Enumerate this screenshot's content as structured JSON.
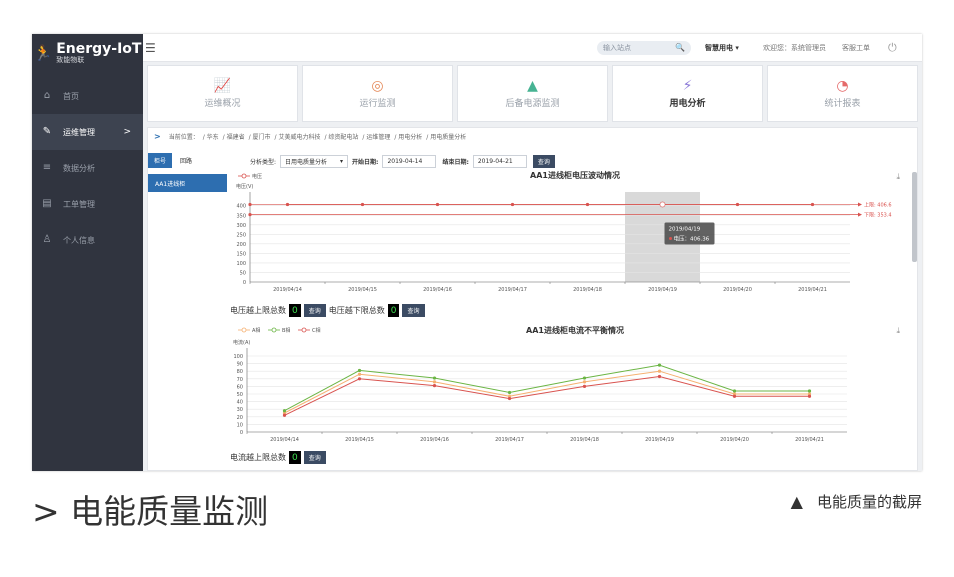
{
  "logo": {
    "name": "Energy-IoT",
    "sub": "致能物联"
  },
  "sidebar": {
    "items": [
      {
        "label": "首页",
        "icon": "home-icon"
      },
      {
        "label": "运维管理",
        "icon": "wrench-icon",
        "active": true,
        "arrow": ">"
      },
      {
        "label": "数据分析",
        "icon": "database-icon"
      },
      {
        "label": "工单管理",
        "icon": "document-icon"
      },
      {
        "label": "个人信息",
        "icon": "user-icon"
      }
    ]
  },
  "topbar": {
    "search_placeholder": "输入站点",
    "menu": "智慧用电",
    "welcome": "欢迎您：系统管理员",
    "service": "客服工单"
  },
  "modules": [
    {
      "label": "运维概况",
      "color": "#58b6d3"
    },
    {
      "label": "运行监测",
      "color": "#e58a5a"
    },
    {
      "label": "后备电源监测",
      "color": "#47b393"
    },
    {
      "label": "用电分析",
      "color": "#8c7ad8",
      "active": true
    },
    {
      "label": "统计报表",
      "color": "#e56a6a"
    }
  ],
  "breadcrumb": [
    "当前位置：",
    "/ 华东",
    "/ 福建省",
    "/ 厦门市",
    "/ 艾美威电力科技",
    "/ 综资配电站",
    "/ 运维管理",
    "/ 用电分析",
    "/ 用电质量分析"
  ],
  "tabs": [
    "柜号",
    "回路"
  ],
  "tree_node": "AA1进线柜",
  "filters": {
    "type_label": "分析类型:",
    "type_value": "日用电质量分析",
    "start_label": "开始日期:",
    "start_value": "2019-04-14",
    "end_label": "结束日期:",
    "end_value": "2019-04-21",
    "query": "查询"
  },
  "voltage_chart": {
    "chart_data": {
      "type": "line",
      "title": "AA1进线柜电压波动情况",
      "ylabel": "电压(V)",
      "categories": [
        "2019/04/14",
        "2019/04/15",
        "2019/04/16",
        "2019/04/17",
        "2019/04/18",
        "2019/04/19",
        "2019/04/20",
        "2019/04/21"
      ],
      "series": [
        {
          "name": "电压",
          "values": [
            406.4,
            406.4,
            406.4,
            406.4,
            406.4,
            406.36,
            406.4,
            406.4
          ],
          "color": "#d9534f"
        }
      ],
      "yticks": [
        0,
        50,
        100,
        150,
        200,
        250,
        300,
        350,
        400
      ],
      "ylim": [
        0,
        430
      ],
      "upper_label": "上限: 406.6",
      "lower_label": "下限: 353.4",
      "upper_value": 406.6,
      "lower_value": 353.4,
      "tooltip_date": "2019/04/19",
      "tooltip_text": "电压：406.36",
      "highlight_index": 5
    }
  },
  "voltage_stats": {
    "upper_label": "电压越上限总数",
    "upper_count": "0",
    "lower_label": "电压越下限总数",
    "lower_count": "0",
    "query": "查询"
  },
  "current_chart": {
    "chart_data": {
      "type": "line",
      "title": "AA1进线柜电流不平衡情况",
      "ylabel": "电流(A)",
      "categories": [
        "2019/04/14",
        "2019/04/15",
        "2019/04/16",
        "2019/04/17",
        "2019/04/18",
        "2019/04/19",
        "2019/04/20",
        "2019/04/21"
      ],
      "series": [
        {
          "name": "A相",
          "values": [
            25,
            76,
            66,
            47,
            66,
            80,
            50,
            50
          ],
          "color": "#f5b070"
        },
        {
          "name": "B相",
          "values": [
            28,
            81,
            71,
            52,
            71,
            88,
            54,
            54
          ],
          "color": "#6bb544"
        },
        {
          "name": "C相",
          "values": [
            22,
            70,
            61,
            44,
            60,
            73,
            47,
            47
          ],
          "color": "#d9534f"
        }
      ],
      "yticks": [
        0,
        10,
        20,
        30,
        40,
        50,
        60,
        70,
        80,
        90,
        100
      ],
      "ylim": [
        0,
        100
      ]
    }
  },
  "current_stats": {
    "upper_label": "电流越上限总数",
    "upper_count": "0",
    "query": "查询"
  },
  "footer": {
    "left": "> 电能质量监测",
    "right_icon": "▲",
    "right": "电能质量的截屏"
  }
}
